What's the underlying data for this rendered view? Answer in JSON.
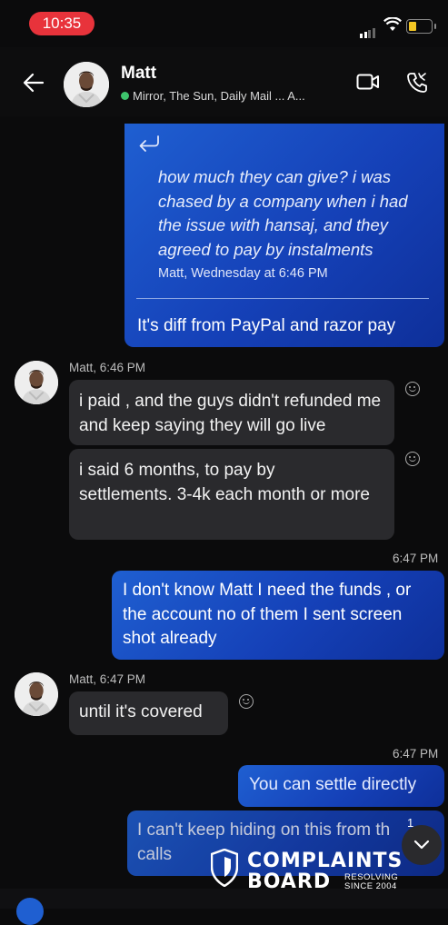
{
  "status_bar": {
    "time": "10:35"
  },
  "header": {
    "name": "Matt",
    "subtitle": "Mirror, The Sun, Daily Mail ... A..."
  },
  "messages": {
    "quoted": {
      "text": "how much they can give? i was chased by a company when i had the issue with hansaj, and they agreed to pay by instalments",
      "meta": "Matt, Wednesday at 6:46 PM"
    },
    "out1": "It's diff from PayPal and razor pay",
    "in_meta1": "Matt, 6:46 PM",
    "in1": "i paid , and the guys didn't refunded me and keep saying they will go live",
    "in2": "i said 6 months, to pay by settlements. 3-4k each month or more",
    "time1": "6:47 PM",
    "out2": "I don't know Matt I need the funds , or the account no of them I sent screen shot already",
    "in_meta2": "Matt, 6:47 PM",
    "in3": "until it's covered",
    "time2": "6:47 PM",
    "out3": "You can settle directly",
    "out4": "I can't keep hiding on this from th calls",
    "unread_badge": "1"
  },
  "watermark": {
    "line1": "COMPLAINTS",
    "line2": "BOARD",
    "tag1": "RESOLVING",
    "tag2": "SINCE 2004"
  },
  "icons": [
    "back-arrow-icon",
    "video-call-icon",
    "phone-call-icon",
    "reply-icon",
    "emoji-reaction-icon",
    "chevron-down-icon",
    "shield-logo-icon"
  ],
  "colors": {
    "accent": "#1f5fd1",
    "online": "#3ec46d",
    "time_pill": "#e8333b"
  }
}
